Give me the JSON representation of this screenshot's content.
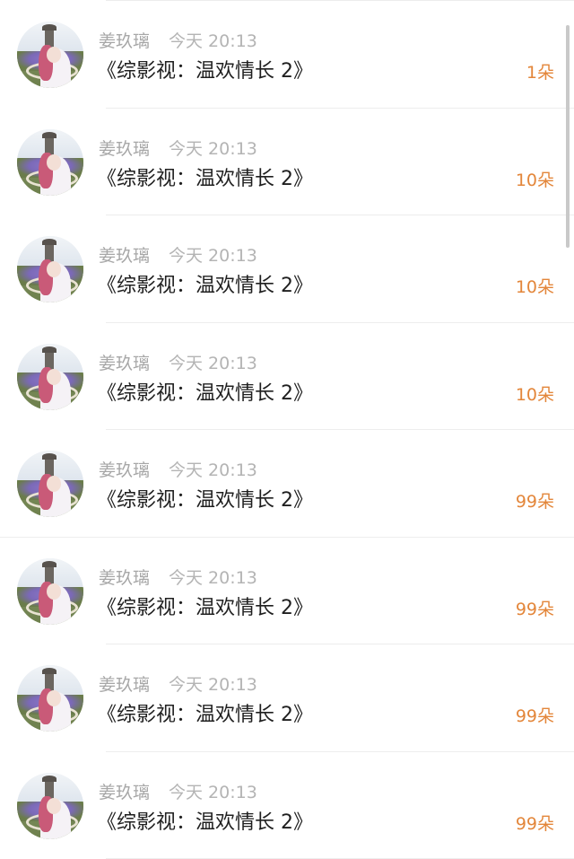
{
  "items": [
    {
      "name": "姜玖璃",
      "time": "今天 20:13",
      "title": "《综影视：温欢情长 2》",
      "count": "1朵"
    },
    {
      "name": "姜玖璃",
      "time": "今天 20:13",
      "title": "《综影视：温欢情长 2》",
      "count": "10朵"
    },
    {
      "name": "姜玖璃",
      "time": "今天 20:13",
      "title": "《综影视：温欢情长 2》",
      "count": "10朵"
    },
    {
      "name": "姜玖璃",
      "time": "今天 20:13",
      "title": "《综影视：温欢情长 2》",
      "count": "10朵"
    },
    {
      "name": "姜玖璃",
      "time": "今天 20:13",
      "title": "《综影视：温欢情长 2》",
      "count": "99朵"
    },
    {
      "name": "姜玖璃",
      "time": "今天 20:13",
      "title": "《综影视：温欢情长 2》",
      "count": "99朵"
    },
    {
      "name": "姜玖璃",
      "time": "今天 20:13",
      "title": "《综影视：温欢情长 2》",
      "count": "99朵"
    },
    {
      "name": "姜玖璃",
      "time": "今天 20:13",
      "title": "《综影视：温欢情长 2》",
      "count": "99朵"
    }
  ],
  "colors": {
    "count_accent": "#e3863a",
    "meta_gray": "#a7a7a7",
    "title_text": "#1f1f1f"
  },
  "icons": {
    "avatar": "user-avatar-photo"
  }
}
